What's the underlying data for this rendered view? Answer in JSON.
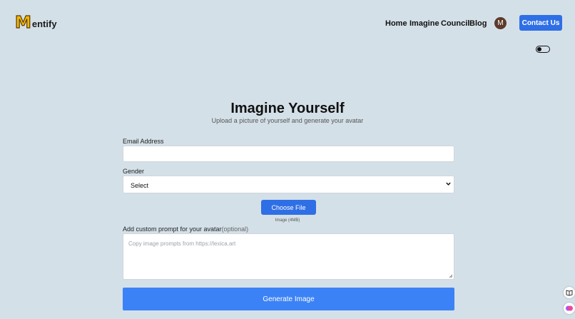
{
  "brand": {
    "initial": "M",
    "rest": "entify"
  },
  "nav": {
    "links": [
      "Home",
      "Imagine",
      "Council",
      "Blog"
    ],
    "avatar_initial": "M",
    "contact_label": "Contact Us"
  },
  "hero": {
    "title": "Imagine Yourself",
    "subtitle": "Upload a picture of yourself and generate your avatar"
  },
  "form": {
    "email_label": "Email Address",
    "email_value": "",
    "gender_label": "Gender",
    "gender_selected": "Select",
    "choose_file_label": "Choose File",
    "file_hint": "Image (4MB)",
    "prompt_label": "Add custom prompt for your avatar",
    "prompt_optional": "(optional)",
    "prompt_placeholder": "Copy image prompts from https://lexica.art",
    "generate_label": "Generate Image"
  },
  "colors": {
    "background": "#d4e0e8",
    "primary": "#2f6fe6",
    "generate": "#3b82f6",
    "logo": "#f2b705"
  }
}
